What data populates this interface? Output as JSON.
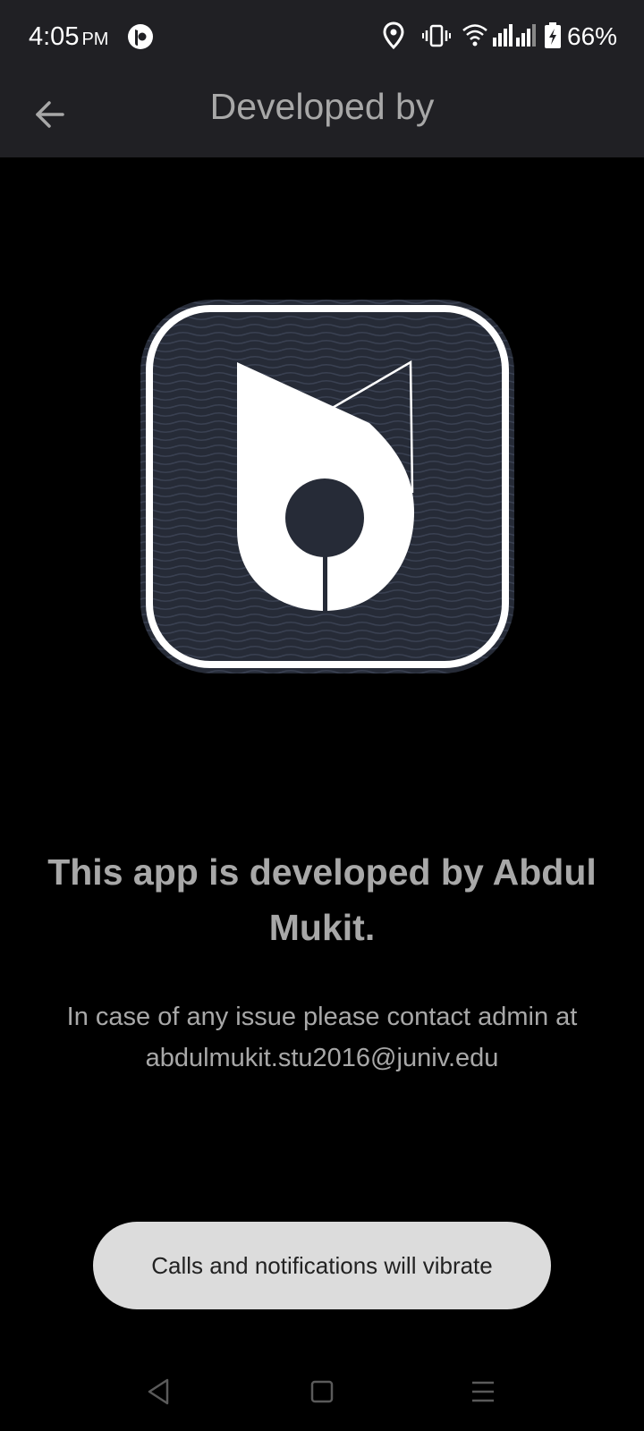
{
  "status_bar": {
    "time": "4:05",
    "ampm": "PM",
    "battery": "66%",
    "icons": [
      "location-icon",
      "vibrate-icon",
      "wifi-icon",
      "signal-icon",
      "signal-icon",
      "battery-charging-icon"
    ]
  },
  "app_bar": {
    "title": "Developed by",
    "back_icon": "arrow-left-icon"
  },
  "content": {
    "headline": "This app is developed by Abdul Mukit.",
    "contact_line": "In case of any issue please contact admin at",
    "email": "abdulmukit.stu2016@juniv.edu"
  },
  "toast": {
    "message": "Calls and notifications will vibrate"
  },
  "nav_bar": {
    "icons": [
      "back-triangle-icon",
      "home-square-icon",
      "recents-menu-icon"
    ]
  },
  "colors": {
    "bar_bg": "#202024",
    "page_bg": "#000000",
    "text_gray": "#a8a8a8",
    "logo_bg": "#2a2f3c",
    "toast_bg": "#dcdcdc"
  }
}
